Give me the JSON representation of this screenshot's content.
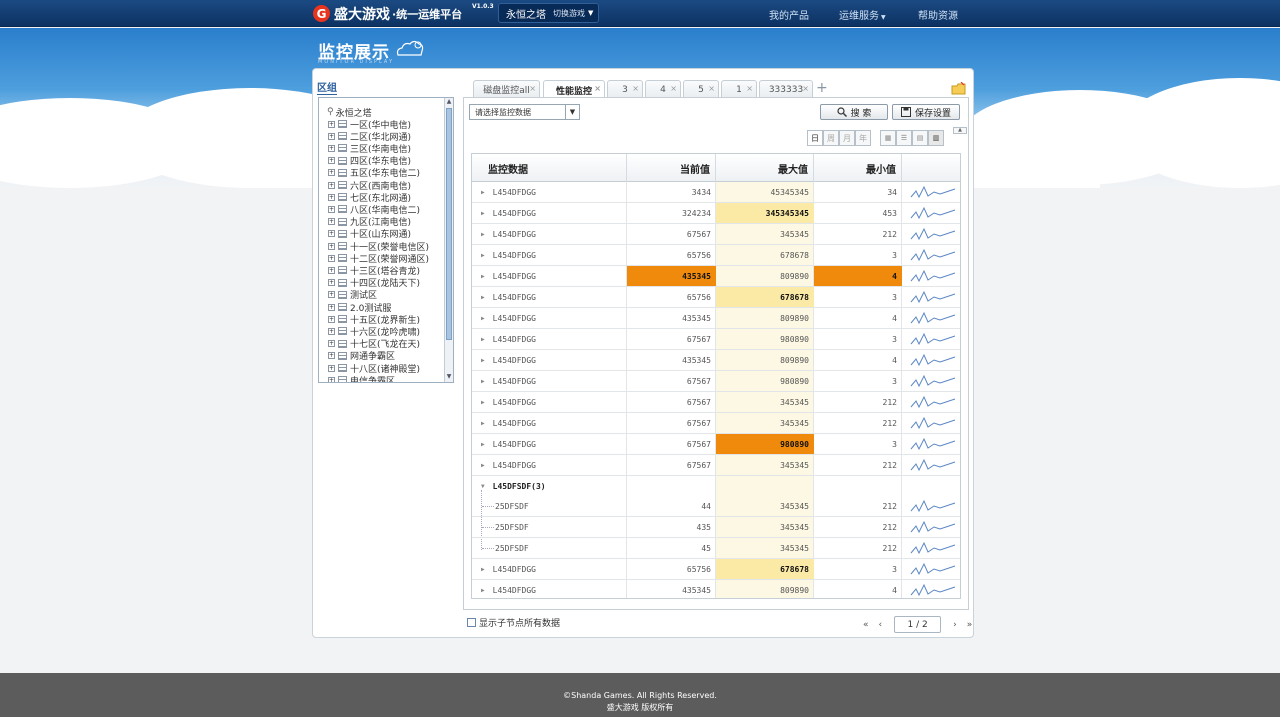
{
  "header": {
    "logo_letter": "G",
    "logo_brand": "盛大游戏",
    "logo_platform": "·统一运维平台",
    "version": "V1.0.3",
    "current_game": "永恒之塔",
    "switch_game_label": "切换游戏",
    "nav": [
      "我的产品",
      "运维服务",
      "帮助资源"
    ]
  },
  "page": {
    "title": "监控展示",
    "title_en": "MONITOR DISPLAY"
  },
  "sidebar": {
    "label": "区组",
    "root": "永恒之塔",
    "items": [
      "一区(华中电信)",
      "二区(华北网通)",
      "三区(华南电信)",
      "四区(华东电信)",
      "五区(华东电信二)",
      "六区(西南电信)",
      "七区(东北网通)",
      "八区(华南电信二)",
      "九区(江南电信)",
      "十区(山东网通)",
      "十一区(荣誉电信区)",
      "十二区(荣誉网通区)",
      "十三区(塔谷青龙)",
      "十四区(龙陆天下)",
      "测试区",
      "2.0测试服",
      "十五区(龙界新生)",
      "十六区(龙吟虎啸)",
      "十七区(飞龙在天)",
      "网通争霸区",
      "十八区(诸神殿堂)",
      "电信争霸区"
    ]
  },
  "tabs": [
    {
      "label": "磁盘监控all",
      "active": false
    },
    {
      "label": "性能监控",
      "active": true
    },
    {
      "label": "3",
      "active": false
    },
    {
      "label": "4",
      "active": false
    },
    {
      "label": "5",
      "active": false
    },
    {
      "label": "1",
      "active": false
    },
    {
      "label": "333333",
      "active": false
    }
  ],
  "toolbar": {
    "select_placeholder": "请选择监控数据",
    "search_label": "搜 索",
    "save_label": "保存设置",
    "periods": [
      "日",
      "周",
      "月",
      "年"
    ]
  },
  "table": {
    "headers": [
      "监控数据",
      "当前值",
      "最大值",
      "最小值"
    ],
    "rows": [
      {
        "name": "L454DFDGG",
        "cur": "3434",
        "max": "45345345",
        "min": "34",
        "hl": ""
      },
      {
        "name": "L454DFDGG",
        "cur": "324234",
        "max": "345345345",
        "min": "453",
        "hl": "max-y"
      },
      {
        "name": "L454DFDGG",
        "cur": "67567",
        "max": "345345",
        "min": "212",
        "hl": ""
      },
      {
        "name": "L454DFDGG",
        "cur": "65756",
        "max": "678678",
        "min": "3",
        "hl": ""
      },
      {
        "name": "L454DFDGG",
        "cur": "435345",
        "max": "809890",
        "min": "4",
        "hl": "cur-o,min-o"
      },
      {
        "name": "L454DFDGG",
        "cur": "65756",
        "max": "678678",
        "min": "3",
        "hl": "max-y"
      },
      {
        "name": "L454DFDGG",
        "cur": "435345",
        "max": "809890",
        "min": "4",
        "hl": ""
      },
      {
        "name": "L454DFDGG",
        "cur": "67567",
        "max": "980890",
        "min": "3",
        "hl": ""
      },
      {
        "name": "L454DFDGG",
        "cur": "435345",
        "max": "809890",
        "min": "4",
        "hl": ""
      },
      {
        "name": "L454DFDGG",
        "cur": "67567",
        "max": "980890",
        "min": "3",
        "hl": ""
      },
      {
        "name": "L454DFDGG",
        "cur": "67567",
        "max": "345345",
        "min": "212",
        "hl": ""
      },
      {
        "name": "L454DFDGG",
        "cur": "67567",
        "max": "345345",
        "min": "212",
        "hl": ""
      },
      {
        "name": "L454DFDGG",
        "cur": "67567",
        "max": "980890",
        "min": "3",
        "hl": "max-o"
      },
      {
        "name": "L454DFDGG",
        "cur": "67567",
        "max": "345345",
        "min": "212",
        "hl": ""
      }
    ],
    "group": {
      "name": "L45DFSDF(3)",
      "children": [
        {
          "name": "25DFSDF",
          "cur": "44",
          "max": "345345",
          "min": "212"
        },
        {
          "name": "25DFSDF",
          "cur": "435",
          "max": "345345",
          "min": "212"
        },
        {
          "name": "25DFSDF",
          "cur": "45",
          "max": "345345",
          "min": "212"
        }
      ]
    },
    "tail_rows": [
      {
        "name": "L454DFDGG",
        "cur": "65756",
        "max": "678678",
        "min": "3",
        "hl": "max-y"
      },
      {
        "name": "L454DFDGG",
        "cur": "435345",
        "max": "809890",
        "min": "4",
        "hl": ""
      }
    ]
  },
  "bottom": {
    "show_children_label": "显示子节点所有数据",
    "page_indicator": "1 / 2"
  },
  "footer": {
    "copyright": "©Shanda Games. All Rights Reserved.",
    "rights_cn": "盛大游戏 版权所有"
  },
  "colors": {
    "highlight_orange": "#f08a0c",
    "highlight_yellow": "#fbe9a6",
    "header_blue": "#0d3262"
  }
}
